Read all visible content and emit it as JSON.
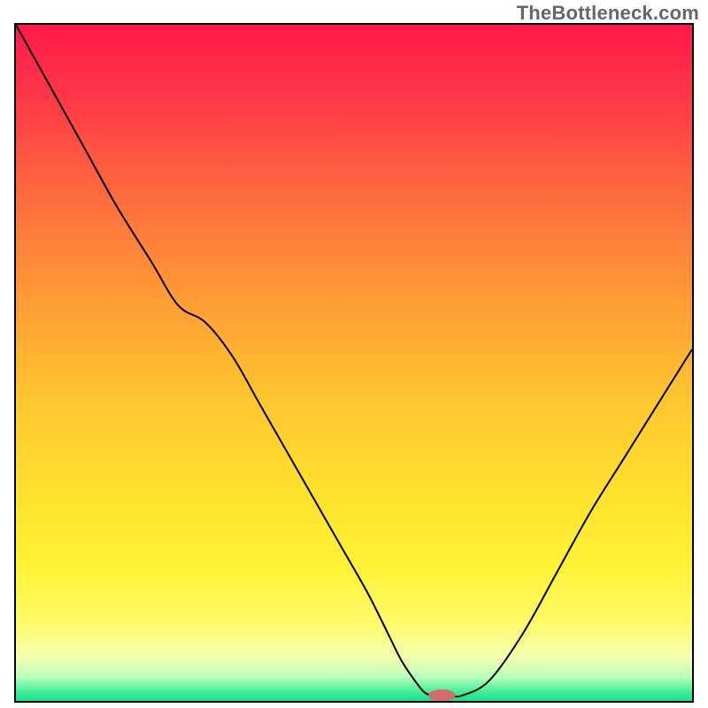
{
  "watermark": "TheBottleneck.com",
  "colors": {
    "border": "#000000",
    "watermark": "#666666",
    "curve": "#000000",
    "marker_fill": "#d46a6a",
    "gradient_stops": [
      {
        "offset": 0.0,
        "color": "#ff1a4b"
      },
      {
        "offset": 0.1,
        "color": "#ff3548"
      },
      {
        "offset": 0.25,
        "color": "#ff6a3e"
      },
      {
        "offset": 0.4,
        "color": "#ff9a36"
      },
      {
        "offset": 0.55,
        "color": "#ffc530"
      },
      {
        "offset": 0.7,
        "color": "#ffe22e"
      },
      {
        "offset": 0.8,
        "color": "#fff236"
      },
      {
        "offset": 0.885,
        "color": "#fffb6a"
      },
      {
        "offset": 0.935,
        "color": "#f4ffb0"
      },
      {
        "offset": 0.965,
        "color": "#b8ffba"
      },
      {
        "offset": 0.985,
        "color": "#4aef9a"
      },
      {
        "offset": 1.0,
        "color": "#16e08a"
      }
    ]
  },
  "chart_data": {
    "type": "line",
    "title": "",
    "xlabel": "",
    "ylabel": "",
    "xlim": [
      0,
      100
    ],
    "ylim": [
      0,
      100
    ],
    "x": [
      0,
      5,
      10,
      15,
      20,
      24,
      28,
      32,
      36,
      40,
      44,
      48,
      52,
      55,
      57,
      59,
      60.5,
      62,
      64,
      66,
      70,
      75,
      80,
      85,
      90,
      95,
      100
    ],
    "values": [
      100,
      91,
      82,
      73,
      65,
      58.5,
      56,
      51,
      44,
      37,
      30,
      23,
      16,
      10,
      6,
      3,
      1.2,
      0.8,
      0.8,
      0.8,
      3,
      10,
      19,
      28,
      36,
      44,
      52
    ],
    "marker": {
      "x": 63,
      "y": 0.8,
      "rx": 2.0,
      "ry": 0.9
    }
  }
}
